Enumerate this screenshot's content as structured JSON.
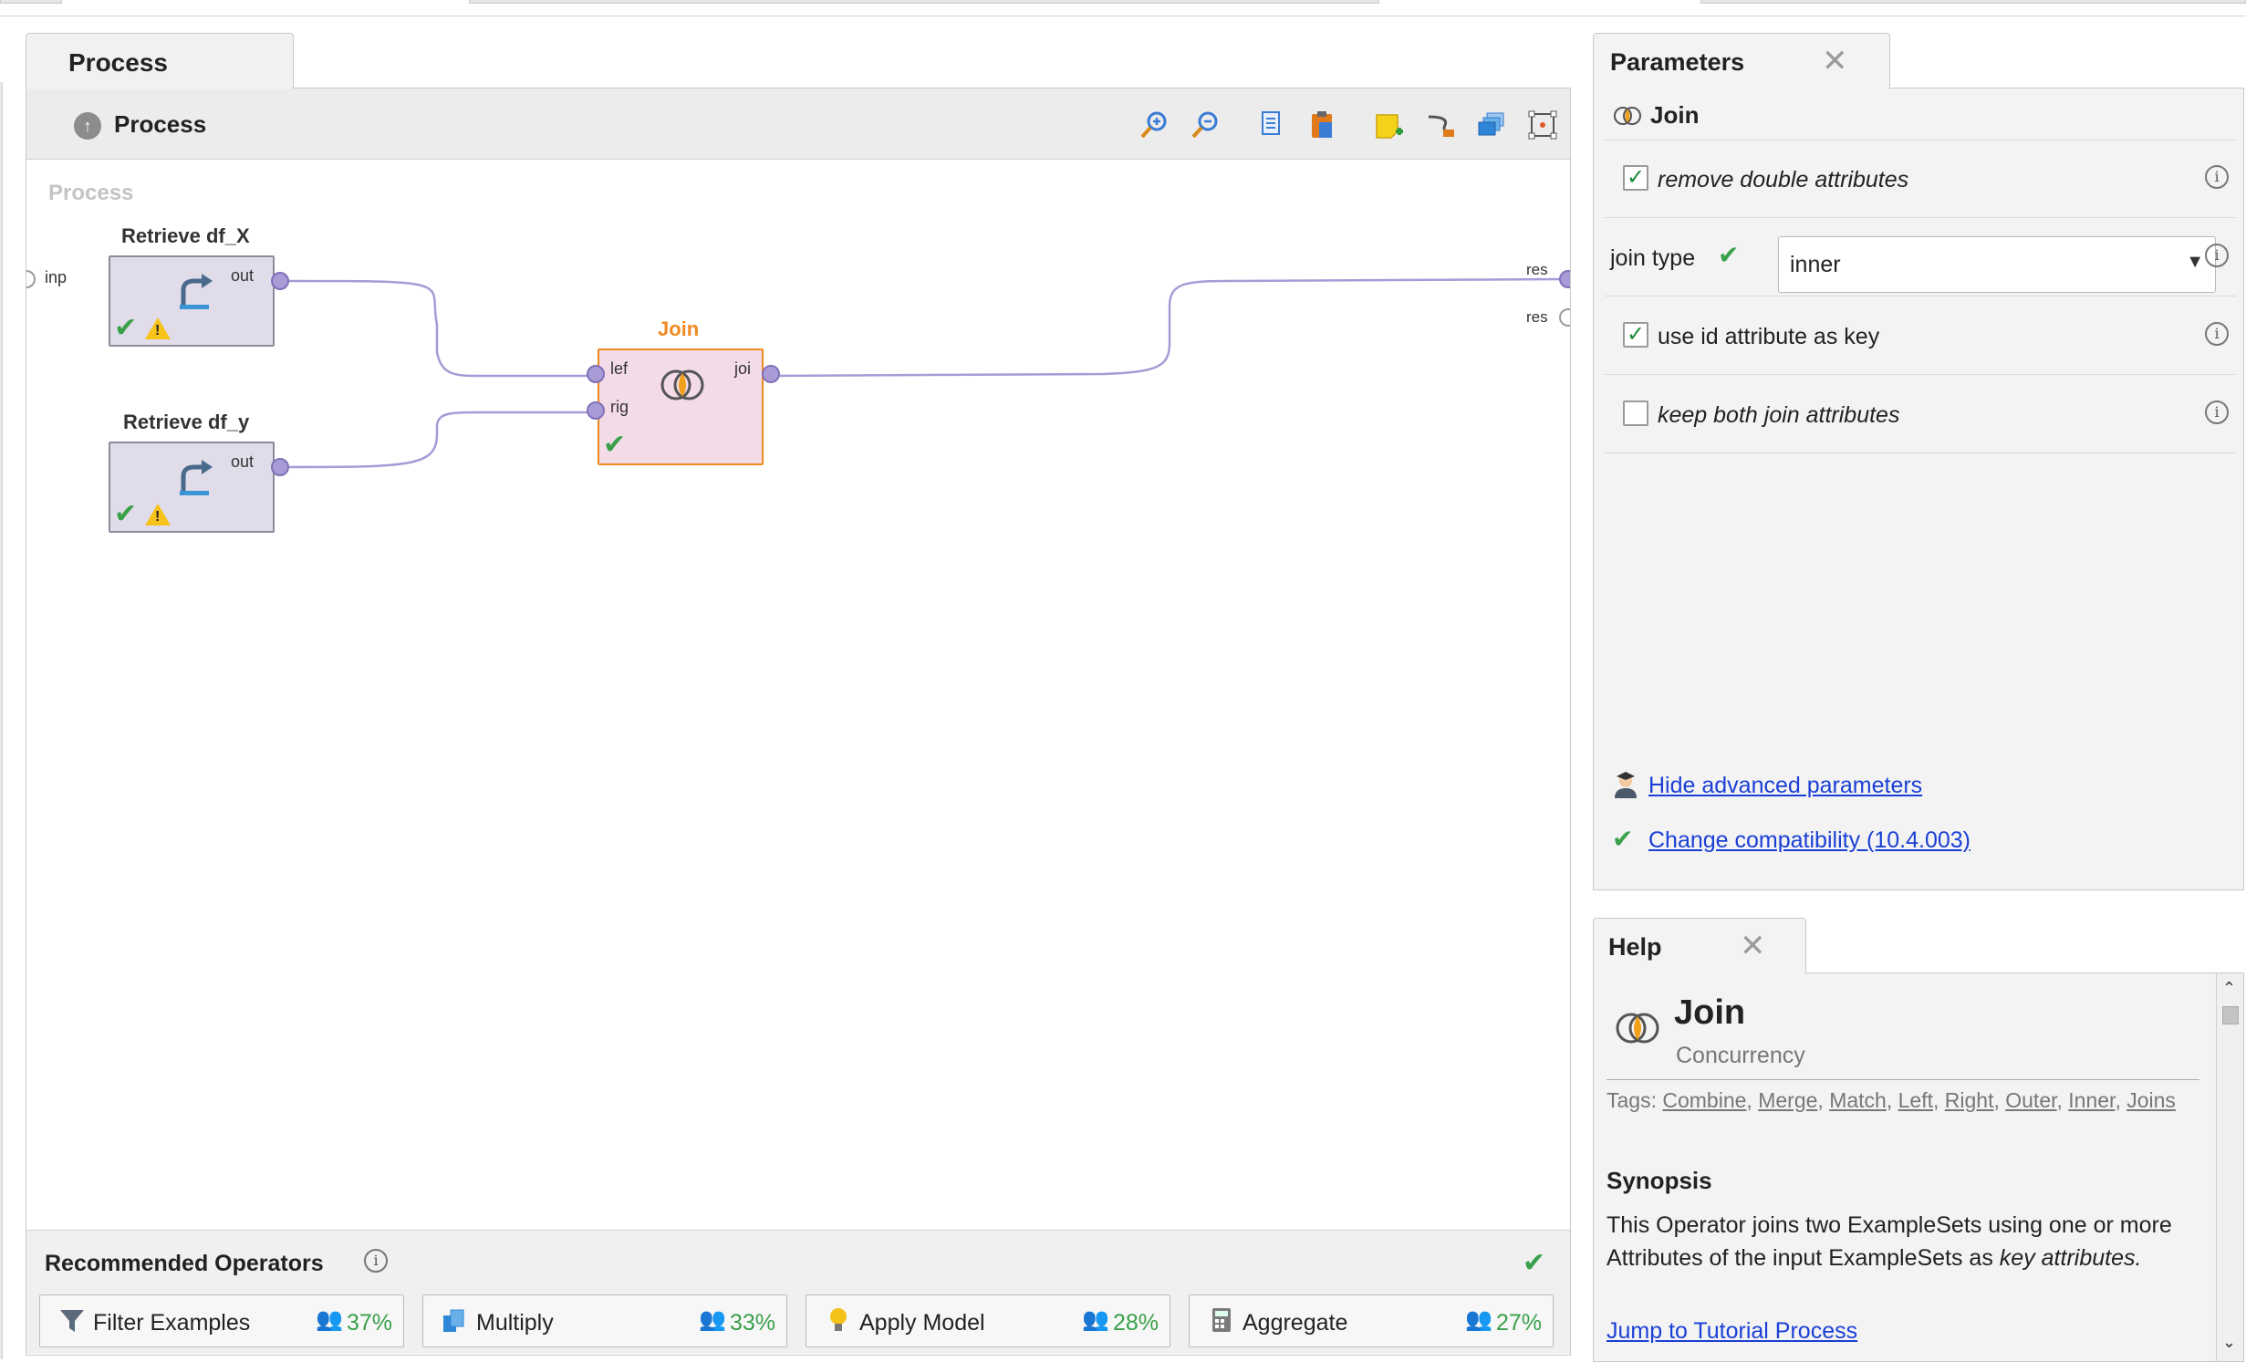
{
  "process_panel": {
    "tab_label": "Process",
    "breadcrumb": "Process",
    "canvas_label": "Process",
    "toolbar_icons": [
      "zoom-in-icon",
      "zoom-out-icon",
      "copy-icon",
      "paste-icon",
      "add-note-icon",
      "auto-wire-icon",
      "arrange-icon",
      "fit-view-icon"
    ]
  },
  "canvas": {
    "input_port": "inp",
    "result_ports": [
      "res",
      "res"
    ],
    "operators": [
      {
        "id": "retrieve_x",
        "title": "Retrieve df_X",
        "out_port": "out",
        "status": [
          "ok",
          "warning"
        ]
      },
      {
        "id": "retrieve_y",
        "title": "Retrieve df_y",
        "out_port": "out",
        "status": [
          "ok",
          "warning"
        ]
      },
      {
        "id": "join",
        "title": "Join",
        "in_ports": [
          "lef",
          "rig"
        ],
        "out_port": "joi",
        "status": [
          "ok"
        ],
        "selected": true
      }
    ]
  },
  "recommended": {
    "title": "Recommended Operators",
    "items": [
      {
        "label": "Filter Examples",
        "percent": "37%",
        "icon": "filter-icon"
      },
      {
        "label": "Multiply",
        "percent": "33%",
        "icon": "multiply-icon"
      },
      {
        "label": "Apply Model",
        "percent": "28%",
        "icon": "lightbulb-icon"
      },
      {
        "label": "Aggregate",
        "percent": "27%",
        "icon": "calculator-icon"
      }
    ]
  },
  "parameters": {
    "tab_label": "Parameters",
    "operator_name": "Join",
    "rows": [
      {
        "type": "checkbox",
        "label": "remove double attributes",
        "checked": true,
        "italic": true
      },
      {
        "type": "select",
        "label": "join type",
        "value": "inner"
      },
      {
        "type": "checkbox",
        "label": "use id attribute as key",
        "checked": true,
        "italic": false
      },
      {
        "type": "checkbox",
        "label": "keep both join attributes",
        "checked": false,
        "italic": true
      }
    ],
    "hide_advanced": "Hide advanced parameters",
    "change_compat": "Change compatibility (10.4.003)"
  },
  "help": {
    "tab_label": "Help",
    "title": "Join",
    "subtitle": "Concurrency",
    "tags_prefix": "Tags:",
    "tags": [
      "Combine",
      "Merge",
      "Match",
      "Left",
      "Right",
      "Outer",
      "Inner",
      "Joins"
    ],
    "synopsis_heading": "Synopsis",
    "synopsis_text": "This Operator joins two ExampleSets using one or more Attributes of the input ExampleSets as ",
    "synopsis_em": "key attributes",
    "synopsis_end": ".",
    "tutorial_link": "Jump to Tutorial Process"
  },
  "colors": {
    "accent_orange": "#f08a1f",
    "port_purple": "#a89bd6",
    "ok_green": "#3aa04a",
    "link_blue": "#1a3fd6"
  }
}
